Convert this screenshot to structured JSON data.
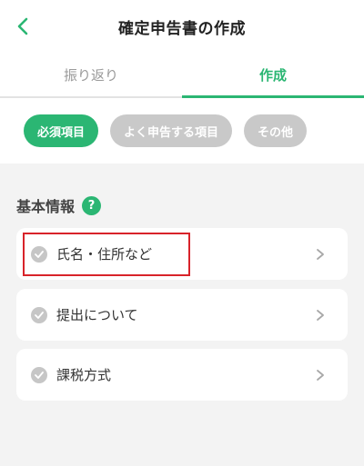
{
  "header": {
    "title": "確定申告書の作成",
    "back_icon": "chevron-left-icon",
    "accent_color": "#2bb673"
  },
  "tabs": [
    {
      "label": "振り返り",
      "active": false
    },
    {
      "label": "作成",
      "active": true
    }
  ],
  "chips": [
    {
      "label": "必須項目",
      "selected": true
    },
    {
      "label": "よく申告する項目",
      "selected": false
    },
    {
      "label": "その他",
      "selected": false
    }
  ],
  "section": {
    "title": "基本情報",
    "help_icon": "?"
  },
  "items": [
    {
      "label": "氏名・住所など",
      "status_icon": "check-circle-icon",
      "highlighted": true
    },
    {
      "label": "提出について",
      "status_icon": "check-circle-icon",
      "highlighted": false
    },
    {
      "label": "課税方式",
      "status_icon": "check-circle-icon",
      "highlighted": false
    }
  ],
  "colors": {
    "accent": "#2bb673",
    "chip_inactive": "#c9c9c9",
    "highlight_border": "#d8232a"
  }
}
